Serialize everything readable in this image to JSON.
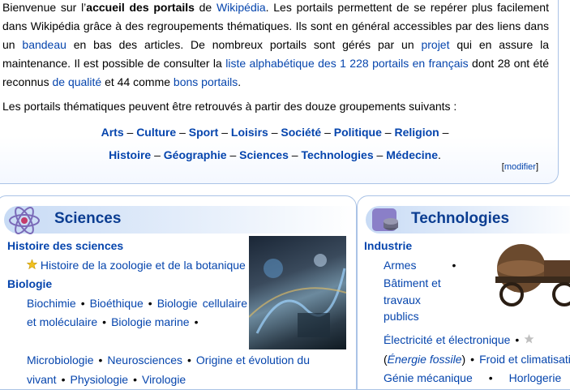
{
  "intro": {
    "t1": "Bienvenue sur l’",
    "t1_bold": "accueil des portails",
    "t2": " de ",
    "link_wikipedia": "Wikipédia",
    "t3": ". Les portails permettent de se repérer plus facilement dans Wikipédia grâce à des regroupements thématiques. Ils sont en général accessibles par des liens dans un ",
    "link_bandeau": "bandeau",
    "t4": " en bas des articles. De nombreux portails sont gérés par un ",
    "link_projet": "projet",
    "t5": " qui en assure la maintenance. Il est possible de consulter la ",
    "link_liste": "liste alphabétique des 1 228 portails en français",
    "t6": " dont 28 ont été reconnus ",
    "link_qualite": "de qualité",
    "t7": " et 44 comme ",
    "link_bons": "bons portails",
    "t8": ".",
    "second_para": "Les portails thématiques peuvent être retrouvés à partir des douze groupements suivants :",
    "groups": [
      "Arts",
      "Culture",
      "Sport",
      "Loisirs",
      "Société",
      "Politique",
      "Religion",
      "Histoire",
      "Géographie",
      "Sciences",
      "Technologies",
      "Médecine"
    ],
    "dash": " – ",
    "end_period": ".",
    "edit_open": "[",
    "edit_label": "modifier",
    "edit_close": "]"
  },
  "sciences": {
    "title": "Sciences",
    "icon": "atom-icon",
    "hist_title": "Histoire des sciences",
    "hist_item": "Histoire de la zoologie et de la botanique",
    "bio_title": "Biologie",
    "bio_items": [
      "Biochimie",
      "Bioéthique",
      "Biologie cellulaire et moléculaire",
      "Biologie marine",
      "Microbiologie",
      "Neurosciences",
      "Origine et évolution du vivant",
      "Physiologie",
      "Virologie"
    ],
    "bullet": "•"
  },
  "technologies": {
    "title": "Technologies",
    "icon": "gear-cylinder-icon",
    "industry_title": "Industrie",
    "items": [
      "Armes",
      "Bâtiment et travaux publics",
      "Électricité et électronique"
    ],
    "energy_open": "(",
    "energy_italic": "Énergie fossile",
    "energy_close": ")",
    "froid": "Froid et climatisation",
    "genie": "Génie mécanique",
    "horlogerie": "Horlogerie",
    "bullet": "•"
  },
  "colors": {
    "link": "#0645ad",
    "panel_border": "#aac3e6",
    "header_gradient": "#c8dbf5",
    "title": "#0b3d91"
  }
}
